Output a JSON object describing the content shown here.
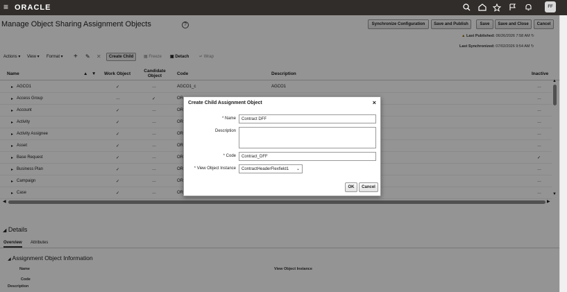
{
  "header": {
    "logo": "ORACLE",
    "avatar": "FF"
  },
  "page": {
    "title": "Manage Object Sharing Assignment Objects",
    "help": "?"
  },
  "actions": {
    "synchronize": "Synchronize Configuration",
    "save_publish": "Save and Publish",
    "save": "Save",
    "save_close": "Save and Close",
    "cancel": "Cancel"
  },
  "status": {
    "last_published_label": "Last Published:",
    "last_published_value": "06/26/2026 7:58 AM",
    "last_synchronized_label": "Last Synchronized:",
    "last_synchronized_value": "07/02/2026 9:54 AM"
  },
  "toolbar": {
    "actions": "Actions",
    "view": "View",
    "format": "Format",
    "create_child": "Create Child",
    "freeze": "Freeze",
    "detach": "Detach",
    "wrap": "Wrap"
  },
  "grid": {
    "columns": {
      "name": "Name",
      "work_object": "Work Object",
      "candidate_object": "Candidate Object",
      "code": "Code",
      "description": "Description",
      "inactive": "Inactive"
    },
    "rows": [
      {
        "name": "AGCO1",
        "work": "✓",
        "candidate": "…",
        "code": "AGCO1_c",
        "description": "AGCO1",
        "inactive": "…"
      },
      {
        "name": "Access Group",
        "work": "…",
        "candidate": "✓",
        "code": "OR",
        "description": "",
        "inactive": "…"
      },
      {
        "name": "Account",
        "work": "✓",
        "candidate": "…",
        "code": "OR",
        "description": "",
        "inactive": "…"
      },
      {
        "name": "Activity",
        "work": "✓",
        "candidate": "…",
        "code": "OR",
        "description": "",
        "inactive": "…"
      },
      {
        "name": "Activity Assignee",
        "work": "✓",
        "candidate": "…",
        "code": "OR",
        "description": "",
        "inactive": "…"
      },
      {
        "name": "Asset",
        "work": "✓",
        "candidate": "…",
        "code": "OR",
        "description": "",
        "inactive": "…"
      },
      {
        "name": "Base Request",
        "work": "✓",
        "candidate": "…",
        "code": "OR",
        "description": "",
        "inactive": "✓"
      },
      {
        "name": "Business Plan",
        "work": "✓",
        "candidate": "…",
        "code": "OR",
        "description": "",
        "inactive": "…"
      },
      {
        "name": "Campaign",
        "work": "✓",
        "candidate": "…",
        "code": "OR",
        "description": "",
        "inactive": "…"
      },
      {
        "name": "Case",
        "work": "✓",
        "candidate": "…",
        "code": "OR",
        "description": "",
        "inactive": "…"
      }
    ]
  },
  "dialog": {
    "title": "Create Child Assignment Object",
    "close": "×",
    "name_label": "Name",
    "name_value": "Contract DFF",
    "description_label": "Description",
    "code_label": "Code",
    "code_value": "Contract_DFF",
    "voi_label": "View Object Instance",
    "voi_value": "ContractHeaderFlexfield1",
    "ok": "OK",
    "cancel": "Cancel",
    "required_mark": "*"
  },
  "details": {
    "title": "Details",
    "tab_overview": "Overview",
    "tab_attributes": "Attributes",
    "section_title": "Assignment Object Information",
    "name_label": "Name",
    "code_label": "Code",
    "description_label": "Description",
    "voi_label": "View Object Instance"
  }
}
